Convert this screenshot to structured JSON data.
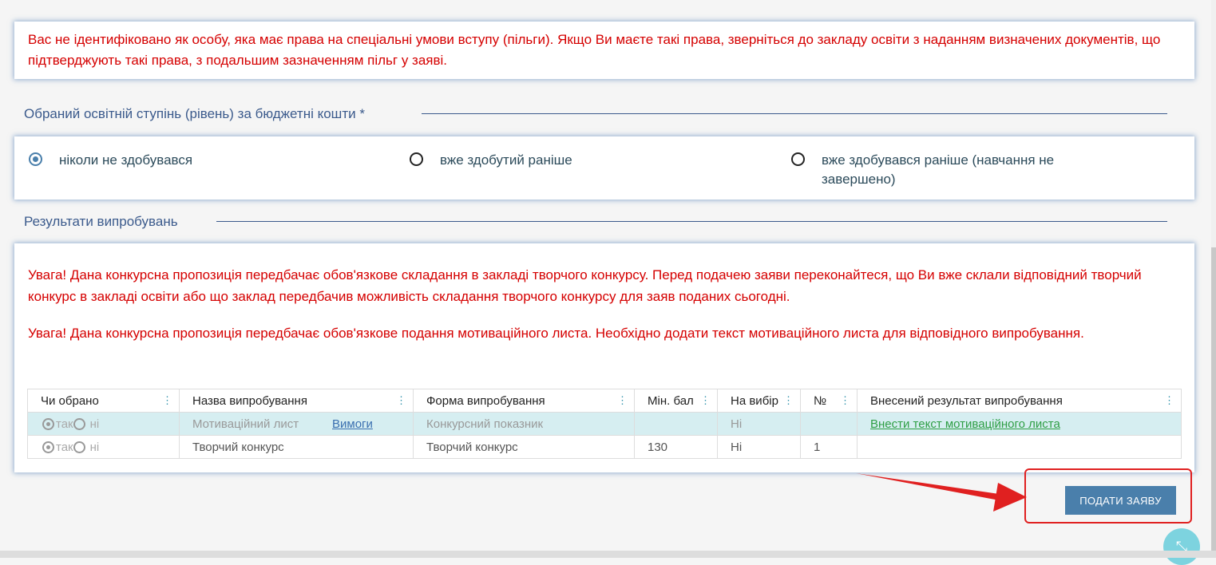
{
  "alert_top": "Вас не ідентифіковано як особу, яка має права на спеціальні умови вступу (пільги). Якщо Ви маєте такі права, зверніться до закладу освіти з наданням визначених документів, що підтверджують такі права, з подальшим зазначенням пільг у заяві.",
  "degree": {
    "title": "Обраний освітній ступінь (рівень) за бюджетні кошти *",
    "options": [
      {
        "label": "ніколи не здобувався",
        "selected": true
      },
      {
        "label": "вже здобутий раніше",
        "selected": false
      },
      {
        "label": "вже здобувався раніше (навчання не завершено)",
        "selected": false
      }
    ]
  },
  "results": {
    "title": "Результати випробувань",
    "warning_1": "Увага! Дана конкурсна пропозиція передбачає обов'язкове складання в закладі творчого конкурсу. Перед подачею заяви переконайтеся, що Ви вже склали відповідний творчий конкурс в закладі освіти або що заклад передбачив можливість складання творчого конкурсу для заяв поданих сьогодні.",
    "warning_2": "Увага! Дана конкурсна пропозиція передбачає обов'язкове подання мотиваційного листа. Необхідно додати текст мотиваційного листа для відповідного випробування.",
    "table": {
      "columns": [
        "Чи обрано",
        "Назва випробування",
        "Форма випробування",
        "Мін. бал",
        "На вибір",
        "№",
        "Внесений результат випробування"
      ],
      "yes_label": "так",
      "no_label": "ні",
      "rows": [
        {
          "name": "Мотиваційний лист",
          "name_link": "Вимоги",
          "form": "Конкурсний показник",
          "min_score": "",
          "optional": "Ні",
          "number": "",
          "result": "Внести текст мотиваційного листа"
        },
        {
          "name": "Творчий конкурс",
          "name_link": "",
          "form": "Творчий конкурс",
          "min_score": "130",
          "optional": "Ні",
          "number": "1",
          "result": ""
        }
      ]
    }
  },
  "submit_label": "ПОДАТИ ЗАЯВУ",
  "colors": {
    "alert": "#d50000",
    "accent": "#4a7fab",
    "highlight_row": "#d6eef1",
    "annotation": "#e02020"
  },
  "icons": {
    "fab": "collapse-icon",
    "column_menu": "kebab-icon"
  }
}
